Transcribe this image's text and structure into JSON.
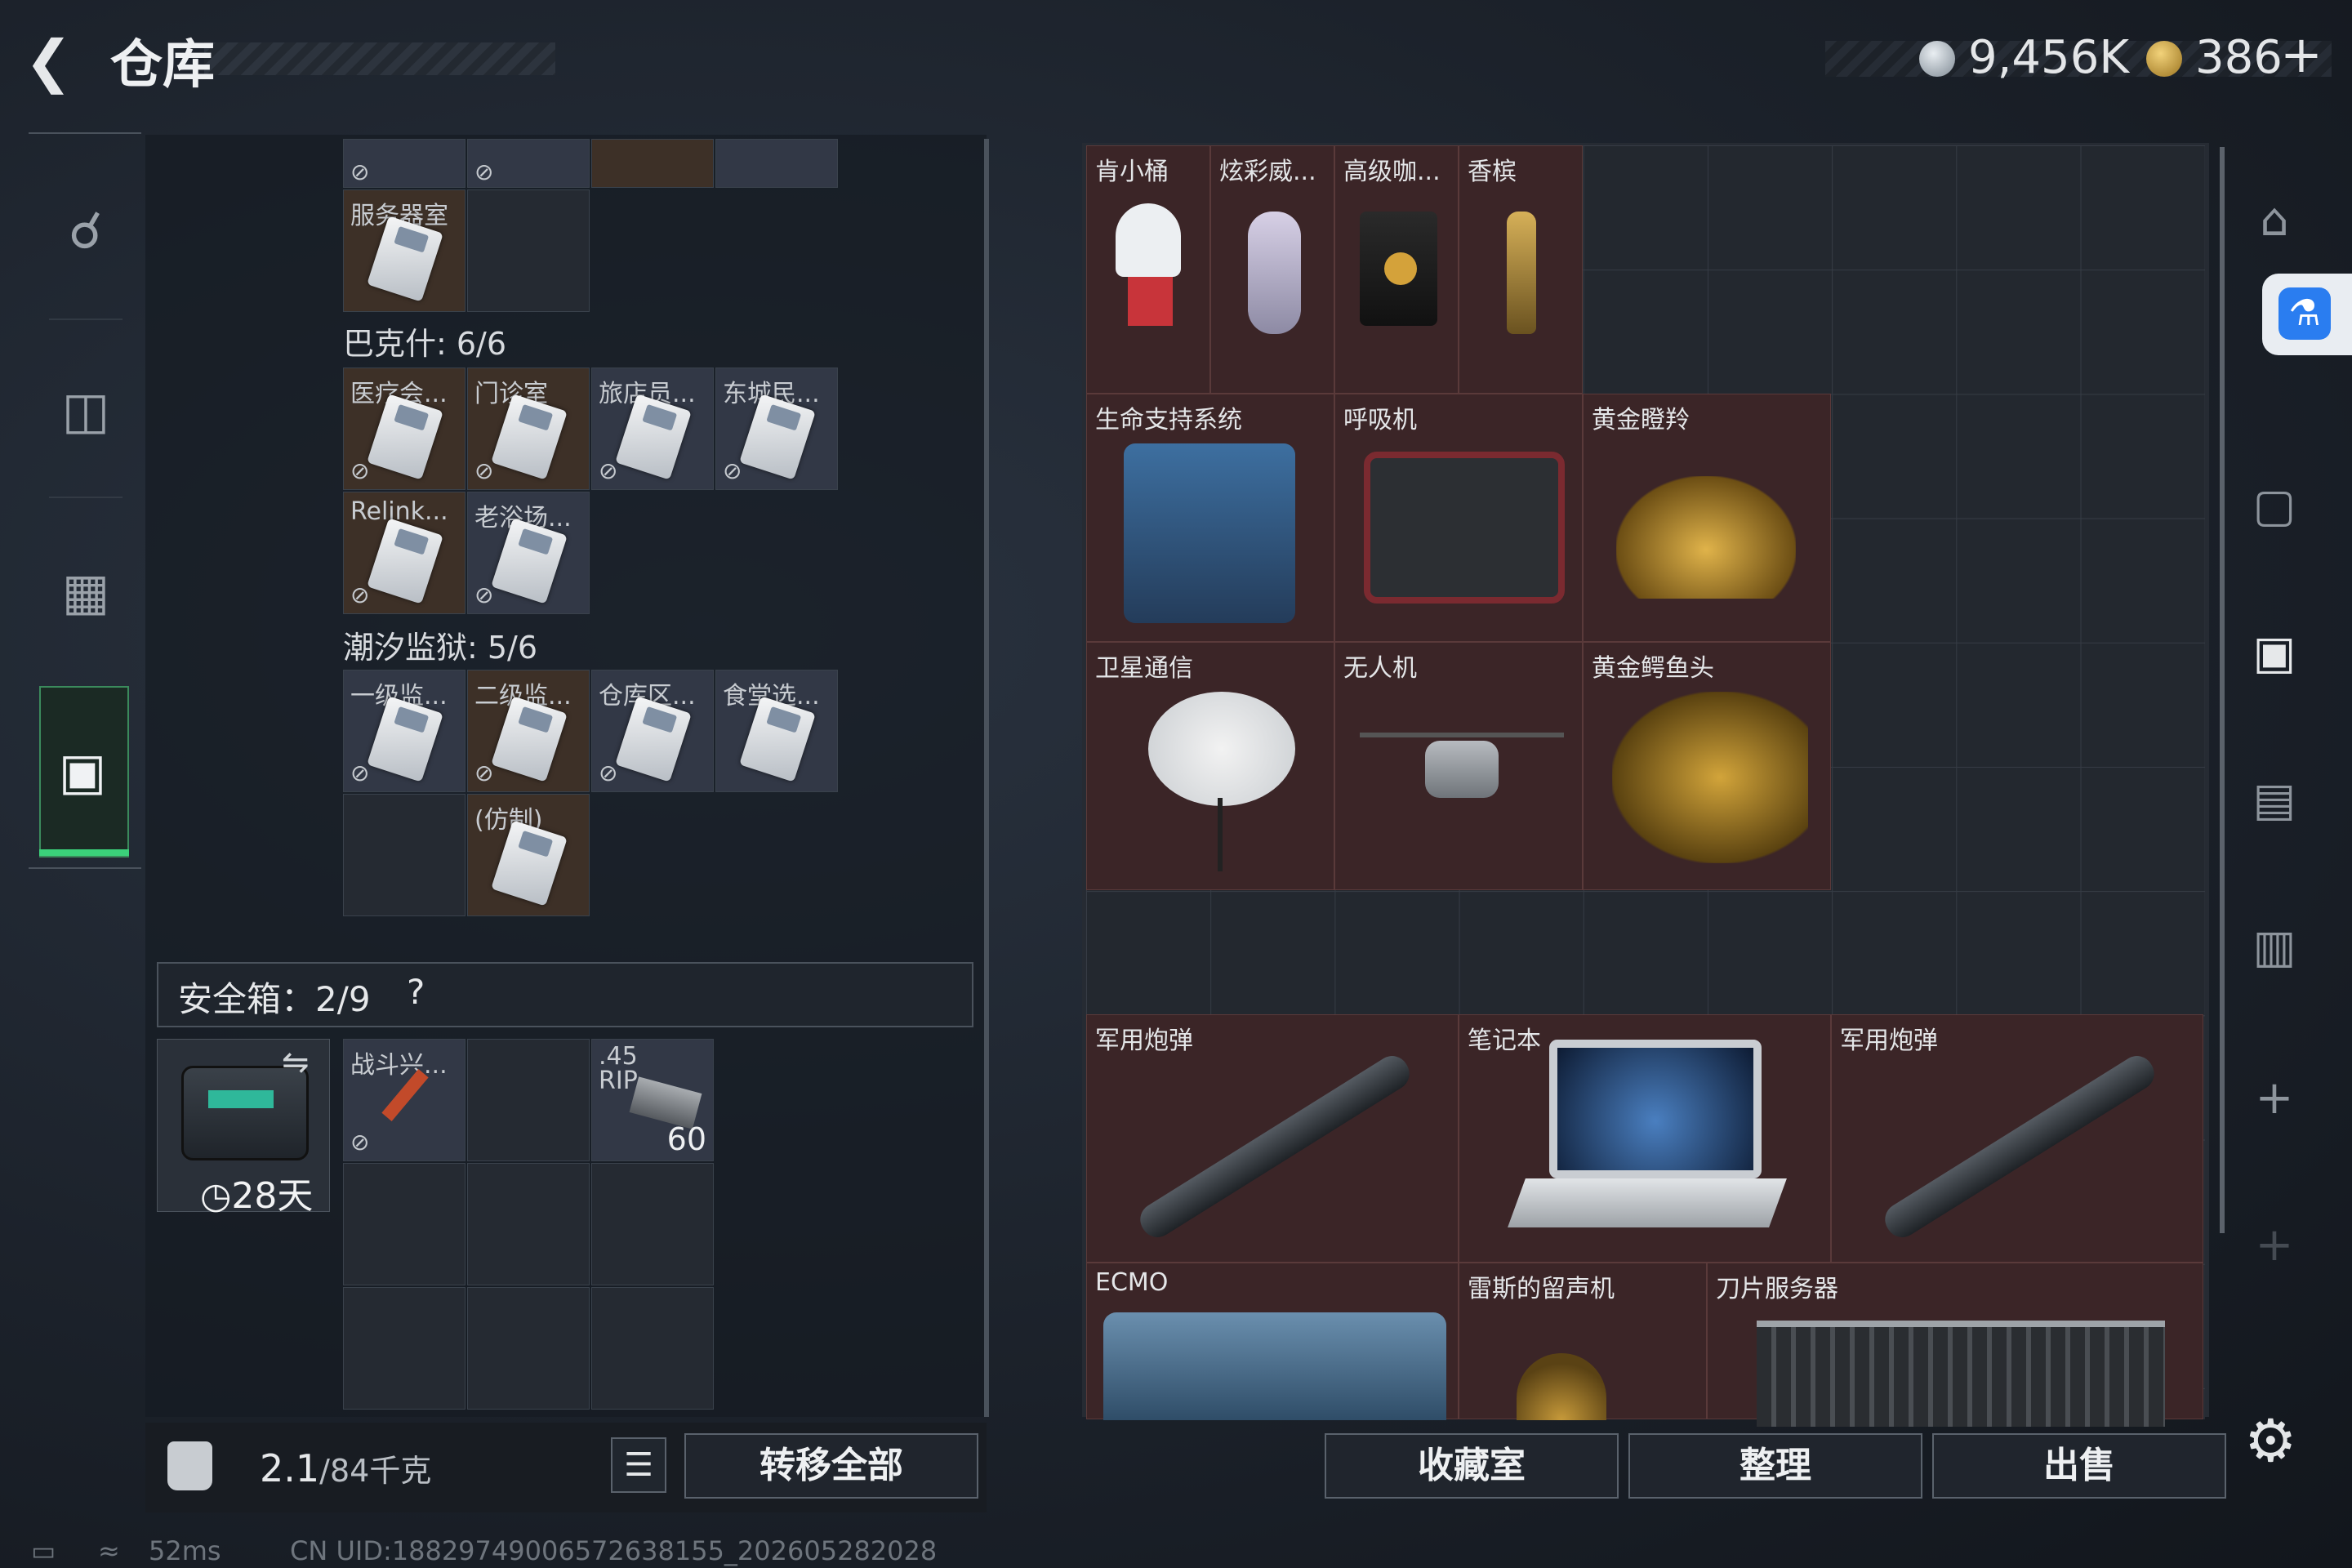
{
  "header": {
    "title": "仓库",
    "currency1": "9,456K",
    "currency2": "386",
    "plus": "+"
  },
  "left_rail": {
    "items": [
      {
        "icon": "gun-icon"
      },
      {
        "icon": "backpack-icon"
      },
      {
        "icon": "vest-icon"
      },
      {
        "icon": "briefcase-icon"
      }
    ]
  },
  "left_panel": {
    "top_cells": [
      {
        "label": "服务器室"
      }
    ],
    "group1": {
      "title": "巴克什: 6/6",
      "cells": [
        "医疗会...",
        "门诊室",
        "旅店员...",
        "东城民...",
        "Relink...",
        "老浴场..."
      ]
    },
    "group2": {
      "title": "潮汐监狱: 5/6",
      "cells": [
        "一级监...",
        "二级监...",
        "仓库区...",
        "食堂选...",
        "(仿制)"
      ]
    },
    "safe": {
      "title": "安全箱：2/9",
      "help": "?",
      "days": "28天",
      "items": [
        {
          "label": "战斗兴..."
        },
        {
          "label": ".45 RIP",
          "count": "60"
        }
      ]
    },
    "weight": {
      "current": "2.1",
      "max": "/84千克"
    },
    "transfer_all": "转移全部"
  },
  "right_panel": {
    "items": [
      {
        "label": "肯小桶"
      },
      {
        "label": "炫彩威..."
      },
      {
        "label": "高级咖..."
      },
      {
        "label": "香槟"
      },
      {
        "label": "生命支持系统"
      },
      {
        "label": "呼吸机"
      },
      {
        "label": "黄金瞪羚"
      },
      {
        "label": "卫星通信"
      },
      {
        "label": "无人机"
      },
      {
        "label": "黄金鳄鱼头"
      },
      {
        "label": "军用炮弹"
      },
      {
        "label": "笔记本"
      },
      {
        "label": "军用炮弹"
      },
      {
        "label": "ECMO"
      },
      {
        "label": "雷斯的留声机"
      },
      {
        "label": "刀片服务器"
      }
    ],
    "buttons": {
      "collection": "收藏室",
      "sort": "整理",
      "sell": "出售"
    }
  },
  "status_bar": {
    "ping": "52ms",
    "uid": "CN UID:18829749006572638155_202605282028"
  },
  "colors": {
    "accent_green": "#3bd17a",
    "item_bg": "#3b2527",
    "access_blue": "#2a7df0"
  }
}
